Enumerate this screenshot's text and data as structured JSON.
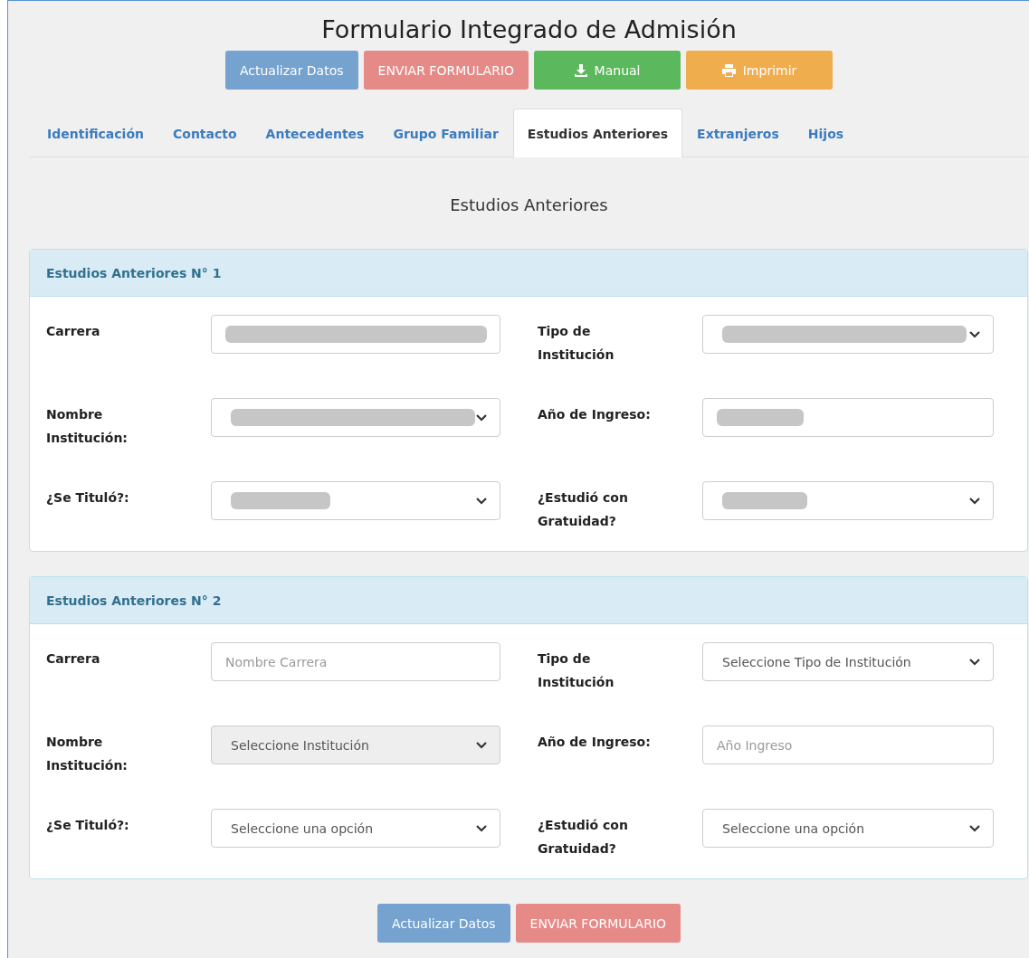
{
  "title": "Formulario Integrado de Admisión",
  "top_buttons": [
    {
      "label": "Actualizar Datos",
      "kind": "update"
    },
    {
      "label": "ENVIAR FORMULARIO",
      "kind": "send"
    },
    {
      "label": "Manual",
      "kind": "manual"
    },
    {
      "label": "Imprimir",
      "kind": "print"
    }
  ],
  "tabs": [
    {
      "label": "Identificación",
      "selected": false
    },
    {
      "label": "Contacto",
      "selected": false
    },
    {
      "label": "Antecedentes",
      "selected": false
    },
    {
      "label": "Grupo Familiar",
      "selected": false
    },
    {
      "label": "Estudios Anteriores",
      "selected": true
    },
    {
      "label": "Extranjeros",
      "selected": false
    },
    {
      "label": "Hijos",
      "selected": false
    }
  ],
  "section_title": "Estudios Anteriores",
  "panels": [
    {
      "title": "Estudios Anteriores N° 1",
      "fields": [
        {
          "label": "Carrera",
          "kind": "input",
          "redacted": true,
          "disabled": false
        },
        {
          "label": "Tipo de Institución",
          "kind": "select",
          "redacted": true,
          "disabled": false
        },
        {
          "label": "Nombre Institución:",
          "kind": "select",
          "redacted": true,
          "disabled": false
        },
        {
          "label": "Año de Ingreso:",
          "kind": "input",
          "redacted": true,
          "disabled": false
        },
        {
          "label": "¿Se Tituló?:",
          "kind": "select",
          "redacted": true,
          "disabled": false
        },
        {
          "label": "¿Estudió con Gratuidad?",
          "kind": "select",
          "redacted": true,
          "disabled": false
        }
      ]
    },
    {
      "title": "Estudios Anteriores N° 2",
      "fields": [
        {
          "label": "Carrera",
          "kind": "input",
          "placeholder": "Nombre Carrera",
          "redacted": false,
          "disabled": false
        },
        {
          "label": "Tipo de Institución",
          "kind": "select",
          "value": "Seleccione Tipo de Institución",
          "redacted": false,
          "disabled": false
        },
        {
          "label": "Nombre Institución:",
          "kind": "select",
          "value": "Seleccione Institución",
          "redacted": false,
          "disabled": true
        },
        {
          "label": "Año de Ingreso:",
          "kind": "input",
          "placeholder": "Año Ingreso",
          "redacted": false,
          "disabled": false
        },
        {
          "label": "¿Se Tituló?:",
          "kind": "select",
          "value": "Seleccione una opción",
          "redacted": false,
          "disabled": false
        },
        {
          "label": "¿Estudió con Gratuidad?",
          "kind": "select",
          "value": "Seleccione una opción",
          "redacted": false,
          "disabled": false
        }
      ]
    }
  ],
  "bottom_buttons": [
    {
      "label": "Actualizar Datos",
      "kind": "update"
    },
    {
      "label": "ENVIAR FORMULARIO",
      "kind": "send"
    }
  ]
}
